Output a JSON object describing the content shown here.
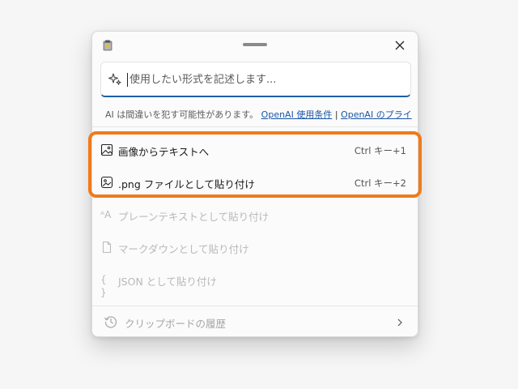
{
  "window": {
    "app_icon": "clipboard-app-icon",
    "drag_handle": "drag-handle",
    "close_icon": "close-icon"
  },
  "prompt": {
    "icon": "sparkle-icon",
    "placeholder": "使用したい形式を記述します...",
    "value": ""
  },
  "disclaimer": {
    "text": "AI は間違いを犯す可能性があります。",
    "link_terms": "OpenAI 使用条件",
    "separator": "|",
    "link_privacy": "OpenAI のプライ"
  },
  "menu": {
    "items": [
      {
        "label": "画像からテキストへ",
        "shortcut": "Ctrl キー+1",
        "icon": "image-icon",
        "enabled": true
      },
      {
        "label": ".png ファイルとして貼り付け",
        "shortcut": "Ctrl キー+2",
        "icon": "image-file-icon",
        "enabled": true
      },
      {
        "label": "プレーンテキストとして貼り付け",
        "shortcut": "",
        "icon": "text-format-icon",
        "icon_glyph": "ᴬA",
        "enabled": false
      },
      {
        "label": "マークダウンとして貼り付け",
        "shortcut": "",
        "icon": "document-icon",
        "enabled": false
      },
      {
        "label": "JSON として貼り付け",
        "shortcut": "",
        "icon": "braces-icon",
        "icon_glyph": "{ }",
        "enabled": false
      }
    ]
  },
  "history": {
    "label": "クリップボードの履歴",
    "icon": "history-icon",
    "chevron": "chevron-right-icon"
  },
  "colors": {
    "accent": "#1f5fa8",
    "highlight": "#f07a1c",
    "link": "#1a56a8"
  }
}
